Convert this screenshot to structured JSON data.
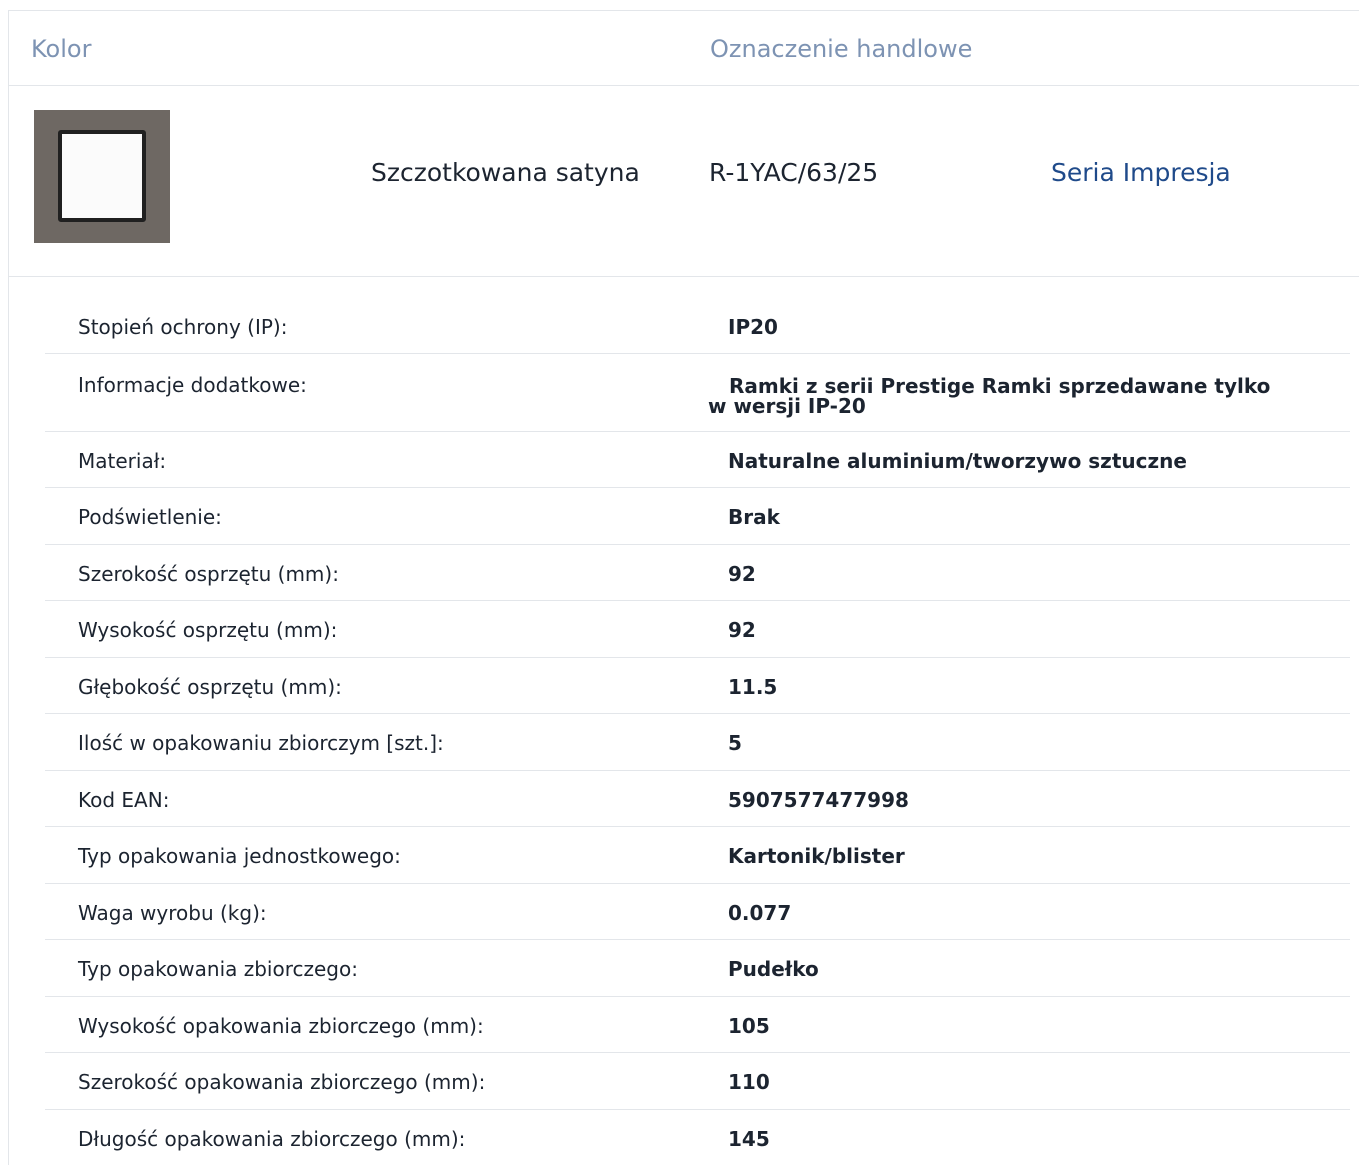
{
  "header": {
    "col_color": "Kolor",
    "col_designation": "Oznaczenie handlowe"
  },
  "product": {
    "color_name": "Szczotkowana satyna",
    "code": "R-1YAC/63/25",
    "series_link": "Seria Impresja",
    "colors": {
      "link": "#1f4a8a",
      "header_label": "#7d93b3"
    }
  },
  "specs": [
    {
      "label": "Stopień ochrony (IP):",
      "value": "IP20"
    },
    {
      "label": "Informacje dodatkowe:",
      "value": "Ramki z serii Prestige Ramki sprzedawane tylko",
      "value2": "w wersji IP-20"
    },
    {
      "label": "Materiał:",
      "value": "Naturalne aluminium/tworzywo sztuczne"
    },
    {
      "label": "Podświetlenie:",
      "value": "Brak"
    },
    {
      "label": "Szerokość osprzętu (mm):",
      "value": "92"
    },
    {
      "label": "Wysokość osprzętu (mm):",
      "value": "92"
    },
    {
      "label": "Głębokość osprzętu (mm):",
      "value": "11.5"
    },
    {
      "label": "Ilość w opakowaniu zbiorczym [szt.]:",
      "value": "5"
    },
    {
      "label": "Kod EAN:",
      "value": "5907577477998"
    },
    {
      "label": "Typ opakowania jednostkowego:",
      "value": "Kartonik/blister"
    },
    {
      "label": "Waga wyrobu (kg):",
      "value": "0.077"
    },
    {
      "label": "Typ opakowania zbiorczego:",
      "value": "Pudełko"
    },
    {
      "label": "Wysokość opakowania zbiorczego (mm):",
      "value": "105"
    },
    {
      "label": "Szerokość opakowania zbiorczego (mm):",
      "value": "110"
    },
    {
      "label": "Długość opakowania zbiorczego (mm):",
      "value": "145"
    }
  ]
}
